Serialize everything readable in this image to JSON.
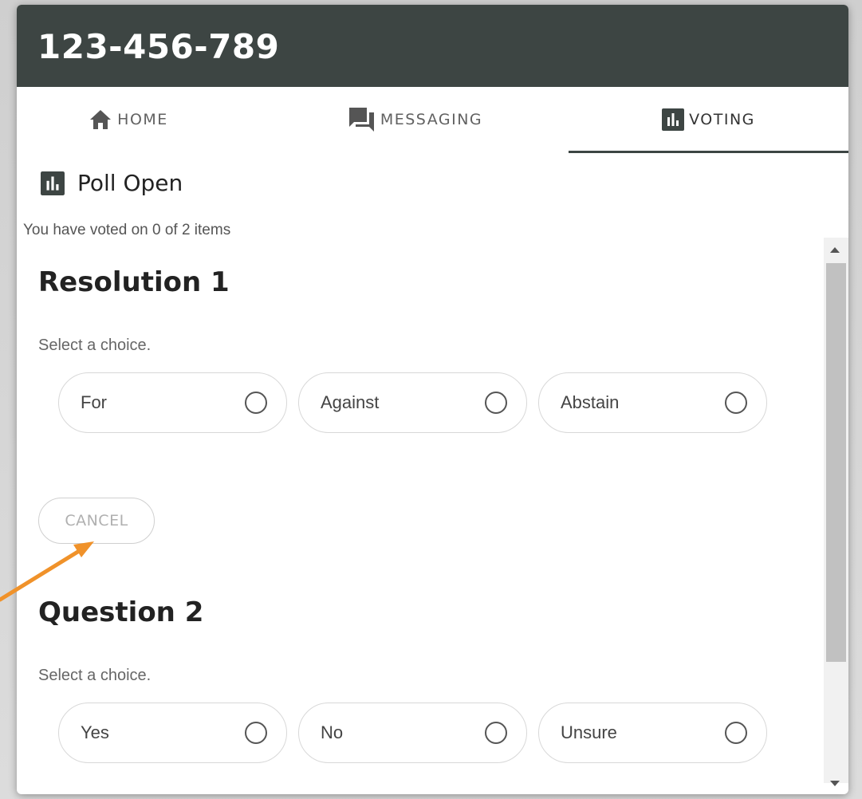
{
  "window": {
    "title": "123-456-789"
  },
  "tabs": [
    {
      "label": "HOME",
      "icon": "home-icon",
      "active": false
    },
    {
      "label": "MESSAGING",
      "icon": "chat-icon",
      "active": false
    },
    {
      "label": "VOTING",
      "icon": "poll-icon",
      "active": true
    }
  ],
  "poll": {
    "status": "Poll Open",
    "vote_count_text": "You have voted on 0 of 2 items"
  },
  "items": [
    {
      "title": "Resolution 1",
      "hint": "Select a choice.",
      "choices": [
        "For",
        "Against",
        "Abstain"
      ],
      "cancel_label": "CANCEL"
    },
    {
      "title": "Question 2",
      "hint": "Select a choice.",
      "choices": [
        "Yes",
        "No",
        "Unsure"
      ]
    }
  ],
  "colors": {
    "titlebar": "#3d4543",
    "annotation_arrow": "#f0922a",
    "active_tab_underline": "#3d4543"
  }
}
